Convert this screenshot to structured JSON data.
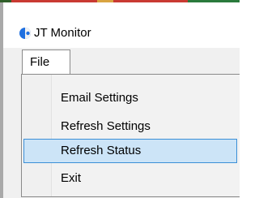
{
  "window": {
    "title": "JT Monitor",
    "accent_color": "#1e6fe0",
    "icon": "jt-monitor-app-icon"
  },
  "menu_bar": {
    "items": [
      {
        "label": "File",
        "open": true
      }
    ]
  },
  "file_menu": {
    "items": [
      {
        "label": "Email Settings",
        "highlighted": false
      },
      {
        "label": "Refresh Settings",
        "highlighted": false
      },
      {
        "label": "Refresh Status",
        "highlighted": true
      },
      {
        "label": "Exit",
        "highlighted": false
      }
    ],
    "highlight_color": "#cce4f7",
    "highlight_border_color": "#3b8fd6"
  }
}
